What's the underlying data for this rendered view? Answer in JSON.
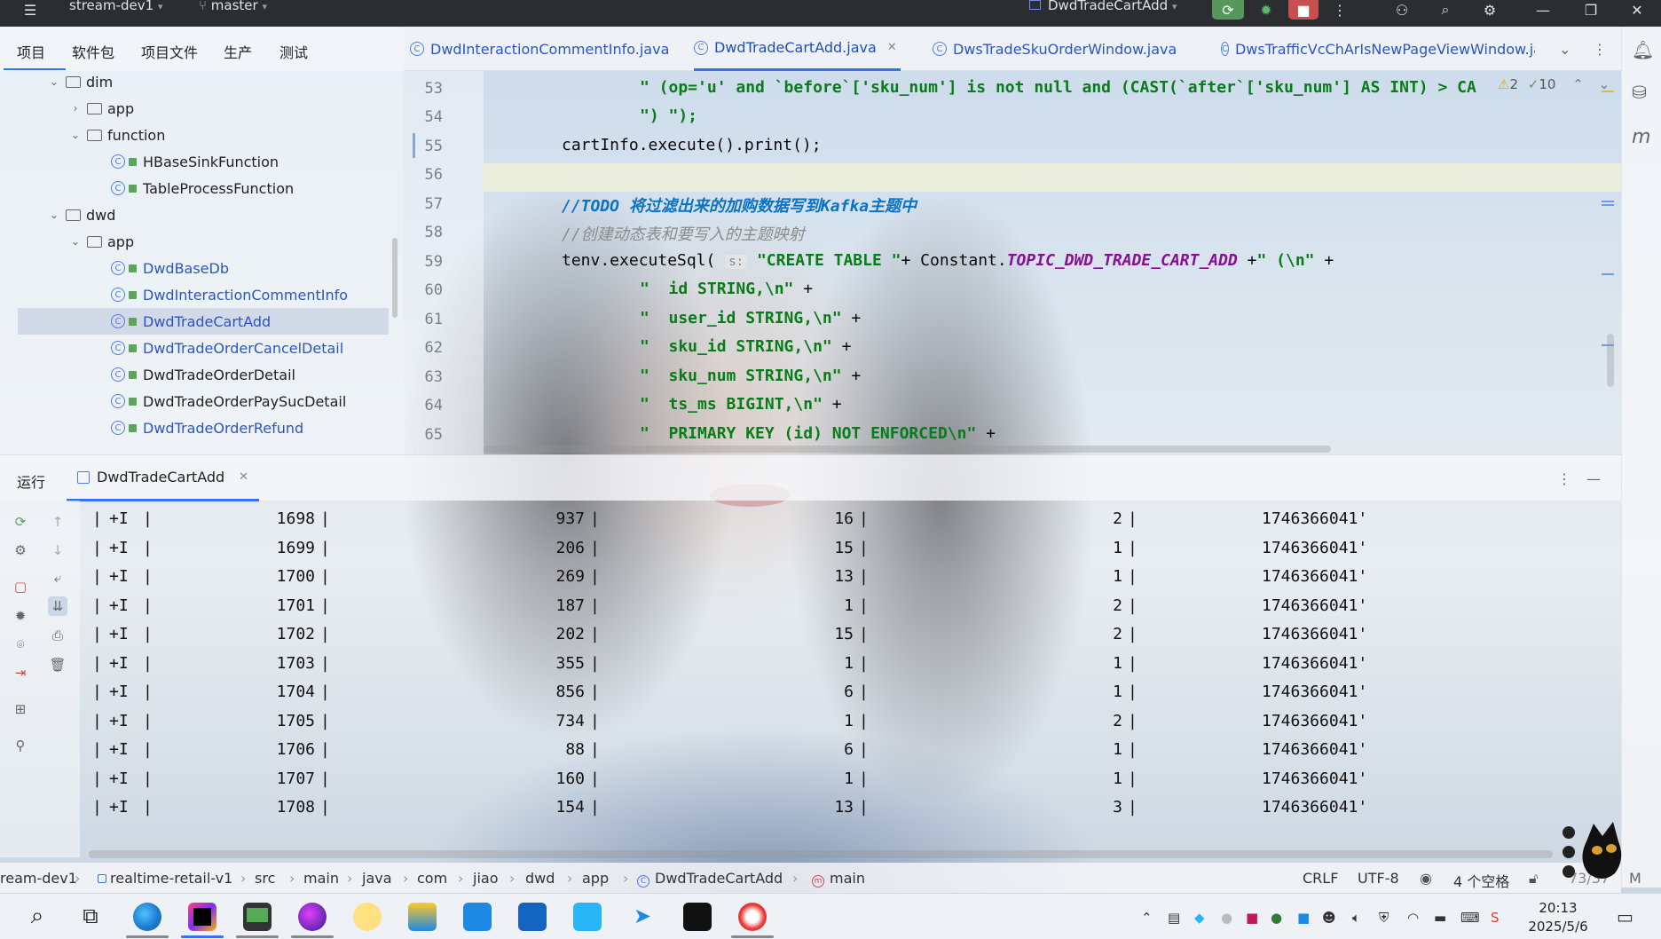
{
  "titlebar": {
    "project": "stream-dev1",
    "branch": "master",
    "run_config": "DwdTradeCartAdd"
  },
  "menubar": {
    "items": [
      "项目",
      "软件包",
      "项目文件",
      "生产",
      "测试"
    ]
  },
  "tabs": [
    {
      "label": "DwdInteractionCommentInfo.java",
      "active": false
    },
    {
      "label": "DwdTradeCartAdd.java",
      "active": true
    },
    {
      "label": "DwsTradeSkuOrderWindow.java",
      "active": false
    },
    {
      "label": "DwsTrafficVcChArIsNewPageViewWindow.ja",
      "active": false
    }
  ],
  "tree": {
    "items": [
      {
        "label": "dim",
        "type": "folder"
      },
      {
        "label": "app",
        "type": "folder"
      },
      {
        "label": "function",
        "type": "folder"
      },
      {
        "label": "HBaseSinkFunction",
        "type": "class"
      },
      {
        "label": "TableProcessFunction",
        "type": "class"
      },
      {
        "label": "dwd",
        "type": "folder"
      },
      {
        "label": "app",
        "type": "folder"
      },
      {
        "label": "DwdBaseDb",
        "type": "class"
      },
      {
        "label": "DwdInteractionCommentInfo",
        "type": "class"
      },
      {
        "label": "DwdTradeCartAdd",
        "type": "class",
        "selected": true
      },
      {
        "label": "DwdTradeOrderCancelDetail",
        "type": "class"
      },
      {
        "label": "DwdTradeOrderDetail",
        "type": "class"
      },
      {
        "label": "DwdTradeOrderPaySucDetail",
        "type": "class"
      },
      {
        "label": "DwdTradeOrderRefund",
        "type": "class"
      }
    ]
  },
  "editor": {
    "line_numbers": [
      "53",
      "54",
      "55",
      "56",
      "57",
      "58",
      "59",
      "60",
      "61",
      "62",
      "63",
      "64",
      "65"
    ],
    "lines": {
      "l53_str": "\" (op='u' and `before`['sku_num'] is not null and (CAST(`after`['sku_num'] AS INT) > CA",
      "l54_str": "\") \");",
      "l55": "cartInfo.execute().print();",
      "l57_todo": "//TODO 将过滤出来的加购数据写到Kafka主题中",
      "l58": "//创建动态表和要写入的主题映射",
      "l59_pre": "tenv.executeSql(",
      "l59_hint": "s:",
      "l59_str1": "\"CREATE TABLE \"",
      "l59_mid": "+ Constant.",
      "l59_const": "TOPIC_DWD_TRADE_CART_ADD",
      "l59_plus": " +",
      "l59_str2": "\" (\\n\"",
      "l59_end": " +",
      "l60_str": "\"  id STRING,\\n\"",
      "l61_str": "\"  user_id STRING,\\n\"",
      "l62_str": "\"  sku_id STRING,\\n\"",
      "l63_str": "\"  sku_num STRING,\\n\"",
      "l64_str": "\"  ts_ms BIGINT,\\n\"",
      "l65_str": "\"  PRIMARY KEY (id) NOT ENFORCED\\n\"",
      "plus": " +"
    },
    "warnings": "2",
    "checks": "10"
  },
  "run_panel": {
    "label": "运行",
    "tab": "DwdTradeCartAdd"
  },
  "console": {
    "rows": [
      {
        "op": "+I",
        "id": "1698",
        "user_id": "937",
        "sku_id": "16",
        "sku_num": "2",
        "ts": "1746366041'"
      },
      {
        "op": "+I",
        "id": "1699",
        "user_id": "206",
        "sku_id": "15",
        "sku_num": "1",
        "ts": "1746366041'"
      },
      {
        "op": "+I",
        "id": "1700",
        "user_id": "269",
        "sku_id": "13",
        "sku_num": "1",
        "ts": "1746366041'"
      },
      {
        "op": "+I",
        "id": "1701",
        "user_id": "187",
        "sku_id": "1",
        "sku_num": "2",
        "ts": "1746366041'"
      },
      {
        "op": "+I",
        "id": "1702",
        "user_id": "202",
        "sku_id": "15",
        "sku_num": "2",
        "ts": "1746366041'"
      },
      {
        "op": "+I",
        "id": "1703",
        "user_id": "355",
        "sku_id": "1",
        "sku_num": "1",
        "ts": "1746366041'"
      },
      {
        "op": "+I",
        "id": "1704",
        "user_id": "856",
        "sku_id": "6",
        "sku_num": "1",
        "ts": "1746366041'"
      },
      {
        "op": "+I",
        "id": "1705",
        "user_id": "734",
        "sku_id": "1",
        "sku_num": "2",
        "ts": "1746366041'"
      },
      {
        "op": "+I",
        "id": "1706",
        "user_id": "88",
        "sku_id": "6",
        "sku_num": "1",
        "ts": "1746366041'"
      },
      {
        "op": "+I",
        "id": "1707",
        "user_id": "160",
        "sku_id": "1",
        "sku_num": "1",
        "ts": "1746366041'"
      },
      {
        "op": "+I",
        "id": "1708",
        "user_id": "154",
        "sku_id": "13",
        "sku_num": "3",
        "ts": "1746366041'"
      }
    ]
  },
  "breadcrumb": {
    "items": [
      "ream-dev1",
      "realtime-retail-v1",
      "src",
      "main",
      "java",
      "com",
      "jiao",
      "dwd",
      "app",
      "DwdTradeCartAdd",
      "main"
    ]
  },
  "statusbar": {
    "line_sep": "CRLF",
    "encoding": "UTF-8",
    "indent": "4 个空格",
    "position": "73/37",
    "mem_suffix": "M"
  },
  "clock": {
    "time": "20:13",
    "date": "2025/5/6"
  },
  "colors": {
    "accent": "#3574f0",
    "string": "#067d17",
    "constant": "#871094",
    "todo": "#0a73c4"
  }
}
